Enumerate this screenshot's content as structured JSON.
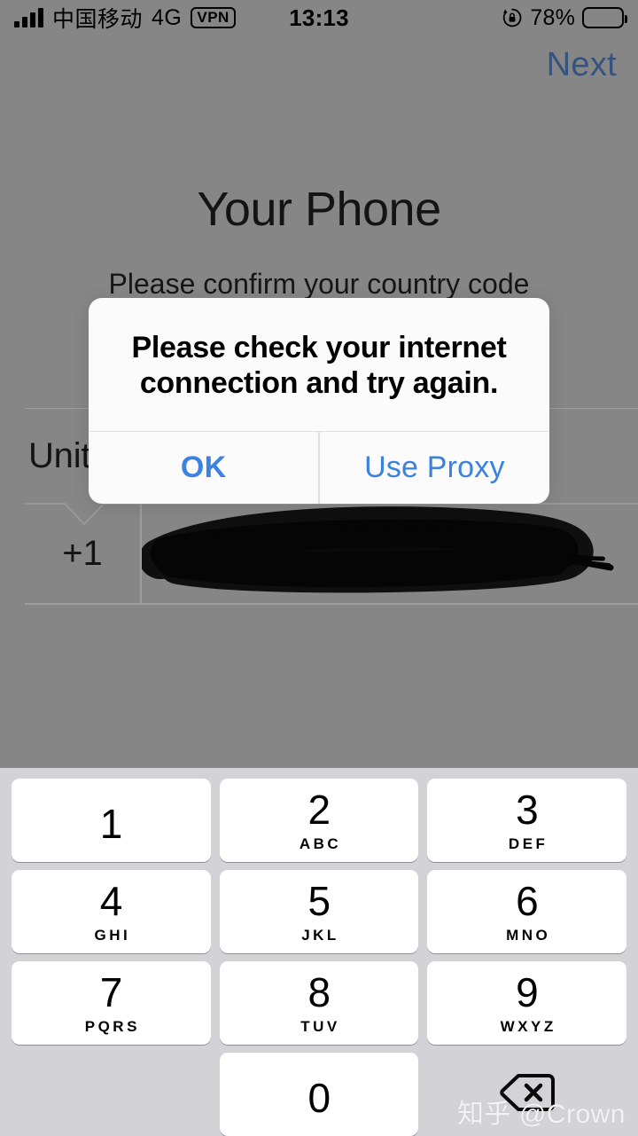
{
  "status_bar": {
    "carrier": "中国移动",
    "network": "4G",
    "vpn_badge": "VPN",
    "time": "13:13",
    "battery_percent": "78%",
    "battery_level": 78,
    "signal_bars": 4,
    "rotation_lock_icon": "rotation-lock-icon"
  },
  "nav": {
    "next_label": "Next",
    "next_color": "#35537e"
  },
  "form": {
    "title": "Your Phone",
    "subtitle": "Please confirm your country code",
    "country_name": "United States",
    "country_name_visible": "Unit",
    "dial_code": "+1",
    "phone_number_value": "",
    "phone_number_redacted": true
  },
  "alert": {
    "title": "Please check your internet connection and try again.",
    "buttons": [
      {
        "label": "OK",
        "name": "alert-ok-button",
        "emphasis": "bold"
      },
      {
        "label": "Use Proxy",
        "name": "alert-use-proxy-button",
        "emphasis": "regular"
      }
    ],
    "accent_color": "#3b82e0"
  },
  "keypad": {
    "rows": [
      [
        {
          "digit": "1",
          "letters": ""
        },
        {
          "digit": "2",
          "letters": "ABC"
        },
        {
          "digit": "3",
          "letters": "DEF"
        }
      ],
      [
        {
          "digit": "4",
          "letters": "GHI"
        },
        {
          "digit": "5",
          "letters": "JKL"
        },
        {
          "digit": "6",
          "letters": "MNO"
        }
      ],
      [
        {
          "digit": "7",
          "letters": "PQRS"
        },
        {
          "digit": "8",
          "letters": "TUV"
        },
        {
          "digit": "9",
          "letters": "WXYZ"
        }
      ]
    ],
    "zero_key": {
      "digit": "0",
      "letters": ""
    },
    "backspace_icon": "backspace-delete-icon"
  },
  "watermark": {
    "text": "知乎 @Crown"
  }
}
